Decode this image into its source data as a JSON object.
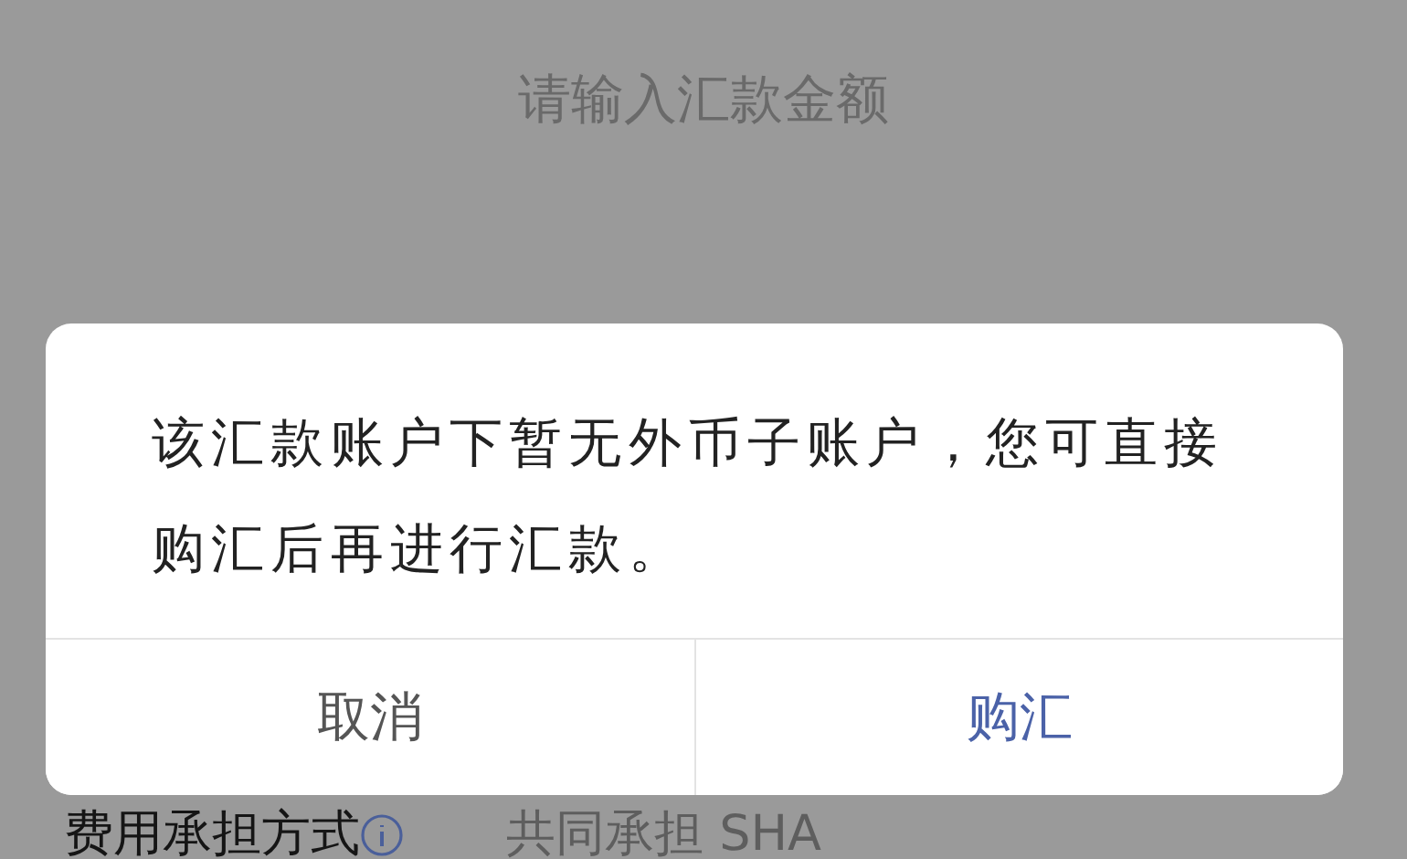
{
  "amount_field": {
    "placeholder": "请输入汇款金额"
  },
  "fee_row": {
    "label": "费用承担方式",
    "value": "共同承担 SHA"
  },
  "dialog": {
    "message": "该汇款账户下暂无外币子账户，您可直接购汇后再进行汇款。",
    "buttons": [
      {
        "label": "取消",
        "kind": "cancel"
      },
      {
        "label": "购汇",
        "kind": "confirm"
      }
    ]
  }
}
